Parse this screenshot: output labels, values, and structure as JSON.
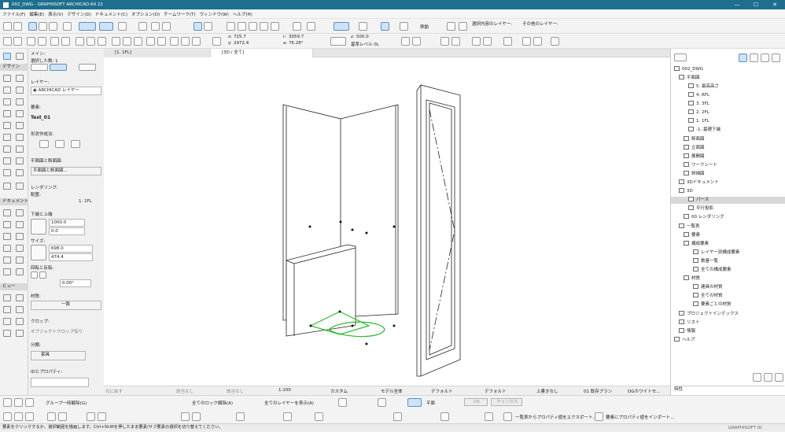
{
  "window": {
    "title": "002_DWG - GRAPHISOFT ARCHICAD-64 22",
    "controls": [
      "—",
      "☐",
      "✕"
    ]
  },
  "menu": [
    "ファイル(F)",
    "編集(E)",
    "表示(V)",
    "デザイン(D)",
    "ドキュメント(C)",
    "オプション(O)",
    "チームワーク(T)",
    "ウィンドウ(W)",
    "ヘルプ(H)"
  ],
  "toolbar": {
    "move_label": "移動",
    "layer_hint_1": "選択内容のレイヤー:",
    "layer_hint_2": "その他のレイヤー:",
    "x": "725.7",
    "y": "2972.4",
    "r": "3059.7",
    "a": "76.28°",
    "z": "500.0",
    "level_label": "基準レベル 0L"
  },
  "left": {
    "sections": {
      "design": "デザイン",
      "document": "ドキュメント",
      "view": "ビュー"
    },
    "info": {
      "main": "メイン:",
      "selected": "選択した数: 1",
      "layer_label": "レイヤー:",
      "layer_value": "ARCHICAD レイヤー",
      "element_label": "要素:",
      "element_value": "Test_01",
      "geometry_label": "形状作成法:",
      "floorplan_label": "平面図と断面図:",
      "floorplan_value": "平面図と断面図...",
      "rendering_label": "レンダリング:",
      "rendering_value": "配置:",
      "story": "1. 1FL",
      "elev_label": "下端と上端",
      "elev_top": "1000.0",
      "elev_bottom": "0.0",
      "size_label": "サイズ:",
      "width": "698.0",
      "depth": "474.4",
      "angle_label": "回転と反転:",
      "angle": "0.00°",
      "material_label": "材質:",
      "material": "一致",
      "crop_label": "クロップ:",
      "crop": "オブジェクトクロップ有り",
      "category_label": "分類:",
      "category": "家具",
      "ids_label": "IDとプロパティ:"
    }
  },
  "tabs": {
    "t1": "[1. 1FL]",
    "t2": "[3D / 全て]"
  },
  "bottombar": {
    "undo_hint": "元に戻す",
    "z1": "該当なし",
    "z2": "該当なし",
    "scale": "1:100",
    "custom": "カスタム",
    "model": "モデル全体",
    "default1": "デフォルト",
    "default2": "デフォルト",
    "override": "上書きなし",
    "plan": "01 既存プラン",
    "white": "OGホワイトモ..."
  },
  "navigator": {
    "root": "002_DWG",
    "plans_label": "平面図",
    "stories": [
      "5. 最高高さ",
      "4. RFL",
      "3. 3FL",
      "2. 2FL",
      "1. 1FL",
      "-1. 基礎下端"
    ],
    "sections": "断面図",
    "elevations": "立面図",
    "interior": "展開図",
    "worksheet": "ワークシート",
    "detail": "詳細図",
    "doc3d": "3Dドキュメント",
    "d3": "3D",
    "perspective": "パース",
    "parallel": "平行投影",
    "rendering": "00 レンダリング",
    "schedules": "一覧表",
    "elements": "要素",
    "components": "構成要素",
    "comp_items": [
      "レイヤー別構成要素",
      "数量一覧",
      "全ての構成要素"
    ],
    "surfaces": "材質",
    "surf_items": [
      "建具の材質",
      "全ての材質",
      "要素ごとの材質"
    ],
    "project_index": "プロジェクトインデックス",
    "lists": "リスト",
    "info": "情報",
    "help": "ヘルプ",
    "properties": "特性"
  },
  "bottomtb": {
    "group_label": "グループ一時解除(G)",
    "lock_label": "全てのロック解除(A)",
    "show_layers": "全てのレイヤーを表示(A)",
    "ok": "OK",
    "cancel": "キャンセル",
    "standard": "平面",
    "export_label": "一覧表からプロパティ値をエクスポート...",
    "import_label": "要素にプロパティ値をインポート..."
  },
  "status": {
    "text": "要素をクリックするか、選択範囲を描画します。Ctrl+Shiftを押したまま要素/サブ要素の選択を切り替えてください。",
    "brand": "GRAPHISOFT ID"
  }
}
